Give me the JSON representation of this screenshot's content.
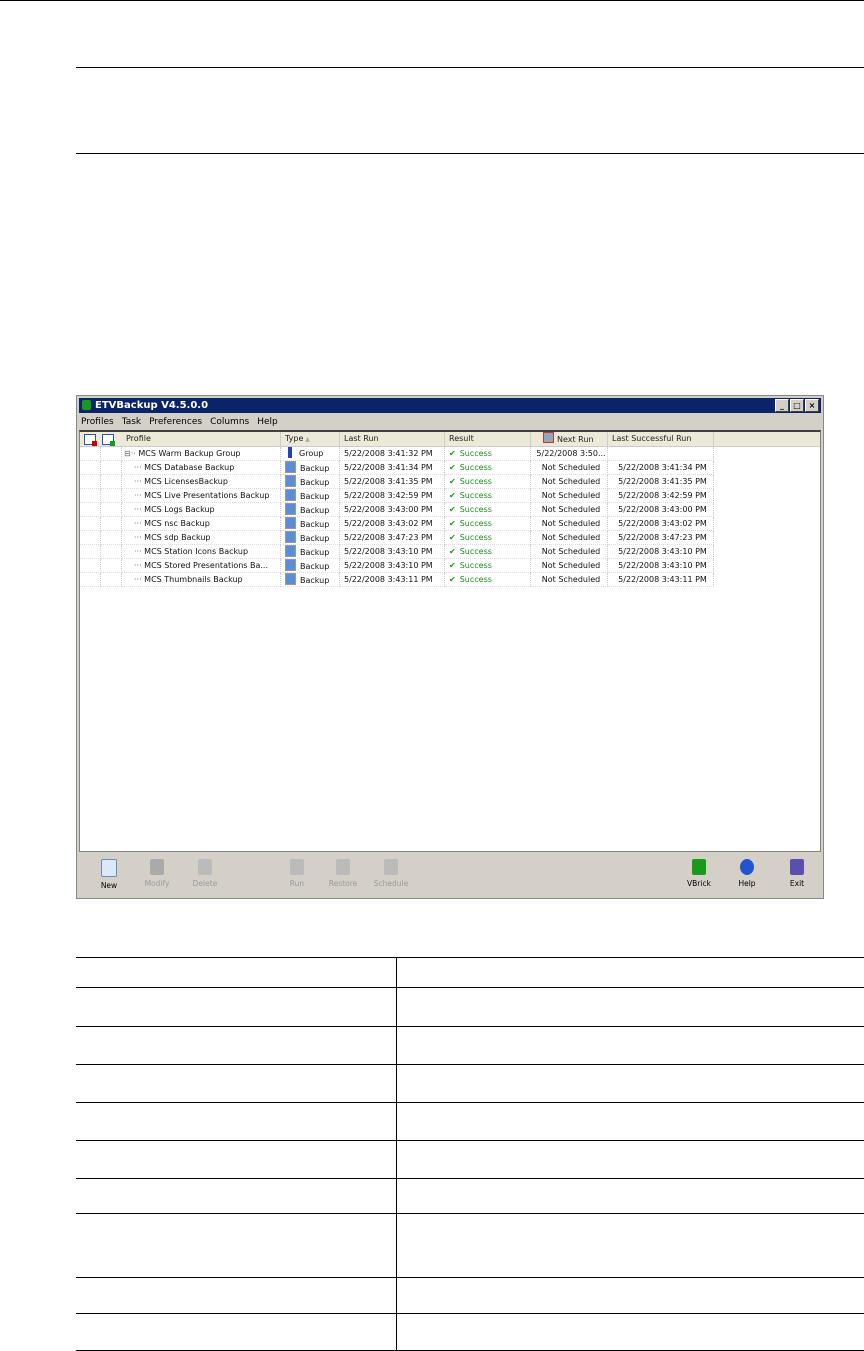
{
  "window": {
    "title": "ETVBackup V4.5.0.0",
    "controls": [
      "_",
      "□",
      "×"
    ]
  },
  "menu": [
    "Profiles",
    "Task",
    "Preferences",
    "Columns",
    "Help"
  ],
  "columns": [
    "Profile",
    "Type",
    "Last Run",
    "Result",
    "Next Run",
    "Last Successful Run"
  ],
  "rows": [
    {
      "profile": "MCS Warm Backup Group",
      "type": "Group",
      "last_run": "5/22/2008 3:41:32 PM",
      "result": "Success",
      "next_run": "5/22/2008 3:50...",
      "last_success": ""
    },
    {
      "profile": "MCS Database Backup",
      "type": "Backup",
      "last_run": "5/22/2008 3:41:34 PM",
      "result": "Success",
      "next_run": "Not Scheduled",
      "last_success": "5/22/2008 3:41:34 PM"
    },
    {
      "profile": "MCS LicensesBackup",
      "type": "Backup",
      "last_run": "5/22/2008 3:41:35 PM",
      "result": "Success",
      "next_run": "Not Scheduled",
      "last_success": "5/22/2008 3:41:35 PM"
    },
    {
      "profile": "MCS Live Presentations Backup",
      "type": "Backup",
      "last_run": "5/22/2008 3:42:59 PM",
      "result": "Success",
      "next_run": "Not Scheduled",
      "last_success": "5/22/2008 3:42:59 PM"
    },
    {
      "profile": "MCS Logs Backup",
      "type": "Backup",
      "last_run": "5/22/2008 3:43:00 PM",
      "result": "Success",
      "next_run": "Not Scheduled",
      "last_success": "5/22/2008 3:43:00 PM"
    },
    {
      "profile": "MCS nsc Backup",
      "type": "Backup",
      "last_run": "5/22/2008 3:43:02 PM",
      "result": "Success",
      "next_run": "Not Scheduled",
      "last_success": "5/22/2008 3:43:02 PM"
    },
    {
      "profile": "MCS sdp Backup",
      "type": "Backup",
      "last_run": "5/22/2008 3:47:23 PM",
      "result": "Success",
      "next_run": "Not Scheduled",
      "last_success": "5/22/2008 3:47:23 PM"
    },
    {
      "profile": "MCS Station Icons Backup",
      "type": "Backup",
      "last_run": "5/22/2008 3:43:10 PM",
      "result": "Success",
      "next_run": "Not Scheduled",
      "last_success": "5/22/2008 3:43:10 PM"
    },
    {
      "profile": "MCS Stored Presentations Ba...",
      "type": "Backup",
      "last_run": "5/22/2008 3:43:10 PM",
      "result": "Success",
      "next_run": "Not Scheduled",
      "last_success": "5/22/2008 3:43:10 PM"
    },
    {
      "profile": "MCS Thumbnails Backup",
      "type": "Backup",
      "last_run": "5/22/2008 3:43:11 PM",
      "result": "Success",
      "next_run": "Not Scheduled",
      "last_success": "5/22/2008 3:43:11 PM"
    }
  ],
  "toolbar": [
    {
      "label": "New",
      "enabled": true,
      "color": "#dbe8f8"
    },
    {
      "label": "Modify",
      "enabled": false,
      "color": "#aaaaaa"
    },
    {
      "label": "Delete",
      "enabled": false,
      "color": "#bbbbbb"
    },
    {
      "label": "Run",
      "enabled": false,
      "color": "#bbbbbb"
    },
    {
      "label": "Restore",
      "enabled": false,
      "color": "#bbbbbb"
    },
    {
      "label": "Schedule",
      "enabled": false,
      "color": "#bbbbbb"
    },
    {
      "label": "VBrick",
      "enabled": true,
      "color": "#1a9a1a"
    },
    {
      "label": "Help",
      "enabled": true,
      "color": "#2255cc"
    },
    {
      "label": "Exit",
      "enabled": true,
      "color": "#5a4fb0"
    }
  ]
}
